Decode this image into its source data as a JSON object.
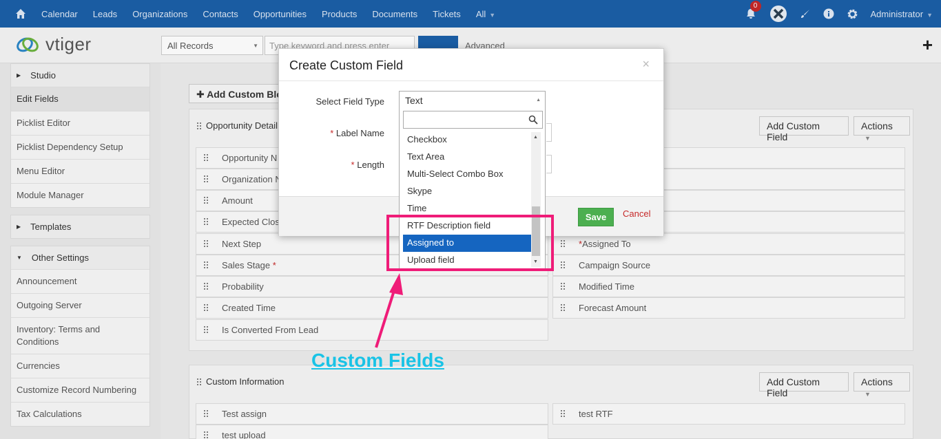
{
  "topnav": {
    "items": [
      "Calendar",
      "Leads",
      "Organizations",
      "Contacts",
      "Opportunities",
      "Products",
      "Documents",
      "Tickets",
      "All"
    ],
    "notification_count": "0",
    "user": "Administrator",
    "bg_color": "#1b5fa8"
  },
  "subbar": {
    "logo_text": "vtiger",
    "records_filter": "All Records",
    "search_placeholder": "Type keyword and press enter",
    "advanced_label": "Advanced"
  },
  "sidebar": {
    "studio_label": "Studio",
    "studio_items": [
      "Edit Fields",
      "Picklist Editor",
      "Picklist Dependency Setup",
      "Menu Editor",
      "Module Manager"
    ],
    "templates_label": "Templates",
    "other_label": "Other Settings",
    "other_items": [
      "Announcement",
      "Outgoing Server",
      "Inventory: Terms and Conditions",
      "Currencies",
      "Customize Record Numbering",
      "Tax Calculations"
    ]
  },
  "main": {
    "add_block_label": "Add Custom Blo",
    "block1": {
      "title": "Opportunity Detail",
      "add_field_label": "Add Custom Field",
      "actions_label": "Actions",
      "left_fields": [
        "Opportunity N",
        "Organization N",
        "Amount",
        "Expected Close",
        "Next Step",
        "Sales Stage",
        "Probability",
        "Created Time",
        "Is Converted From Lead"
      ],
      "right_fields": [
        "Assigned To",
        "Campaign Source",
        "Modified Time",
        "Forecast Amount"
      ]
    },
    "block2": {
      "title": "Custom Information",
      "add_field_label": "Add Custom Field",
      "actions_label": "Actions",
      "left_fields": [
        "Test assign",
        "test upload"
      ],
      "right_fields": [
        "test RTF"
      ]
    }
  },
  "modal": {
    "title": "Create Custom Field",
    "close": "×",
    "field_type_label": "Select Field Type",
    "label_name_label": "Label Name",
    "length_label": "Length",
    "selected_type": "Text",
    "options": [
      "Checkbox",
      "Text Area",
      "Multi-Select Combo Box",
      "Skype",
      "Time",
      "RTF Description field",
      "Assigned to",
      "Upload field"
    ],
    "highlighted_option": "Assigned to",
    "save_label": "Save",
    "cancel_label": "Cancel"
  },
  "annotation": {
    "text": "Custom Fields",
    "color": "#19c3e6",
    "highlight_color": "#ef1c78"
  }
}
